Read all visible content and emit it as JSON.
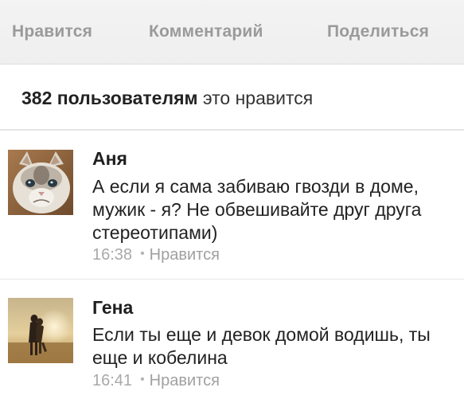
{
  "actions": {
    "like_label": "Нравится",
    "comment_label": "Комментарий",
    "share_label": "Поделиться"
  },
  "likes": {
    "count": "382 пользователям",
    "suffix": "это нравится"
  },
  "comments": [
    {
      "author": "Аня",
      "avatar": "grumpy-cat-avatar",
      "text": "А если я сама забиваю гвозди в доме, мужик - я? Не обвешивайте друг друга стереотипами)",
      "time": "16:38",
      "like_label": "Нравится"
    },
    {
      "author": "Гена",
      "avatar": "couple-sunset-avatar",
      "text": "Если ты еще и девок домой водишь, ты еще и кобелина",
      "time": "16:41",
      "like_label": "Нравится"
    }
  ],
  "colors": {
    "action_text": "#9a9a9a",
    "meta_text": "#a9a9a9",
    "bar_bg": "#f1f1f1"
  }
}
